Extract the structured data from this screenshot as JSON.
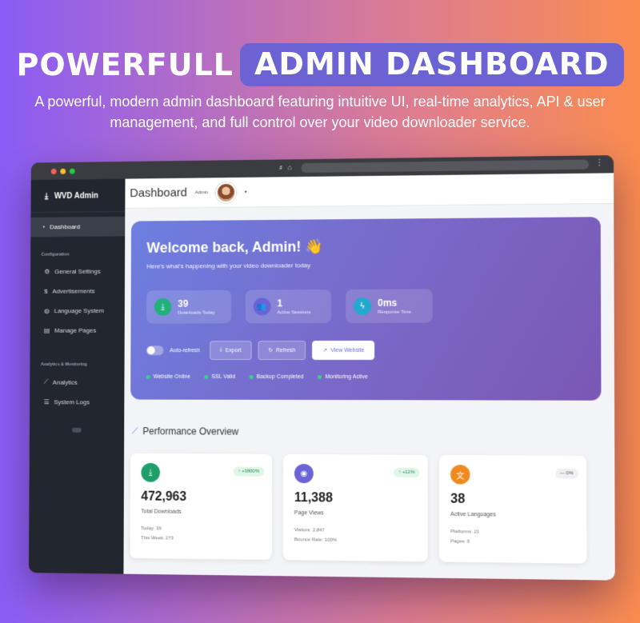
{
  "hero": {
    "title_left": "POWERFULL",
    "title_highlight": "ADMIN DASHBOARD",
    "subtitle": "A powerful, modern admin dashboard featuring intuitive UI, real-time analytics, API & user management, and full control over your video downloader service."
  },
  "sidebar": {
    "brand": "WVD Admin",
    "active_item": "Dashboard",
    "section_config": "Configuration",
    "config_items": [
      "General Settings",
      "Advertisements",
      "Language System",
      "Manage Pages"
    ],
    "section_analytics": "Analytics & Monitoring",
    "analytics_items": [
      "Analytics",
      "System Logs"
    ]
  },
  "topbar": {
    "title": "Dashboard",
    "user_role": "Admin"
  },
  "welcome": {
    "heading": "Welcome back, Admin! 👋",
    "subtext": "Here's what's happening with your video downloader today",
    "stats": [
      {
        "value": "39",
        "label": "Downloads Today",
        "icon": "download-icon",
        "color": "#22b07d"
      },
      {
        "value": "1",
        "label": "Active Sessions",
        "icon": "users-icon",
        "color": "#6b63d4"
      },
      {
        "value": "0ms",
        "label": "Response Time",
        "icon": "bolt-icon",
        "color": "#23a8d1"
      }
    ],
    "toggle_label": "Auto-refresh",
    "buttons": {
      "export": "Export",
      "refresh": "Refresh",
      "view_website": "View Website"
    },
    "statuses": [
      "Website Online",
      "SSL Valid",
      "Backup Completed",
      "Monitoring Active"
    ]
  },
  "performance": {
    "title": "Performance Overview",
    "cards": [
      {
        "value": "472,963",
        "label": "Total Downloads",
        "badge": "+3800%",
        "meta1": "Today: 39",
        "meta2": "This Week: 273",
        "icon": "download-icon",
        "color": "#1f9e6a"
      },
      {
        "value": "11,388",
        "label": "Page Views",
        "badge": "+12%",
        "meta1": "Visitors: 2,847",
        "meta2": "Bounce Rate: 100%",
        "icon": "eye-icon",
        "color": "#6b63d4"
      },
      {
        "value": "38",
        "label": "Active Languages",
        "badge": "0%",
        "meta1": "Platforms: 21",
        "meta2": "Pages: 6",
        "icon": "language-icon",
        "color": "#f08a1e"
      }
    ]
  }
}
